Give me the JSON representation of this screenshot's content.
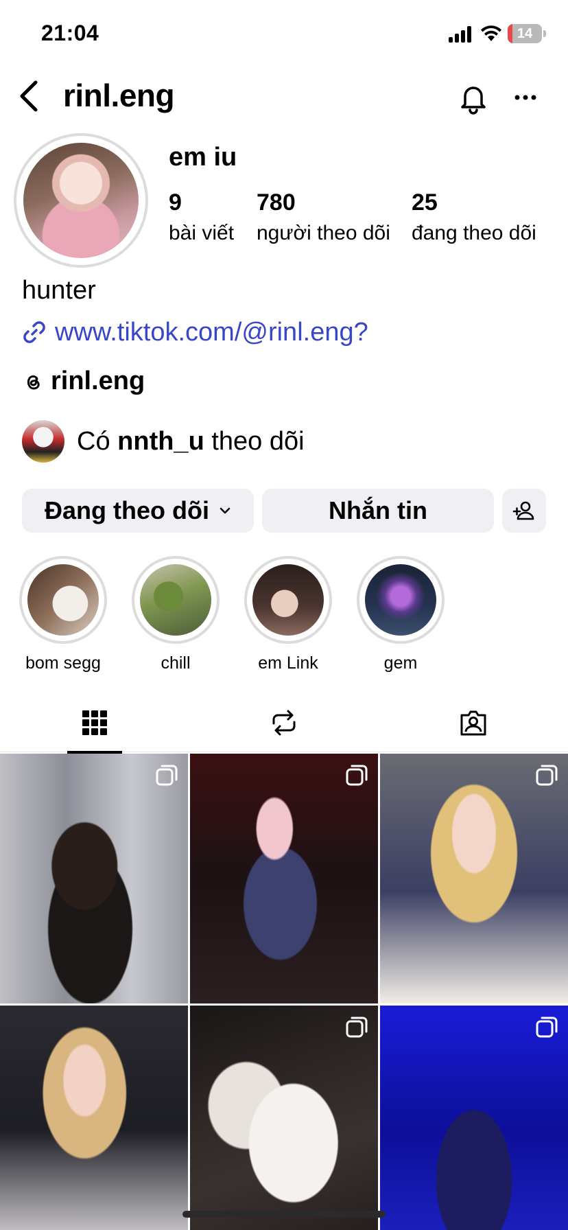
{
  "status_bar": {
    "time": "21:04",
    "battery": "14",
    "battery_level": 0.14
  },
  "header": {
    "username": "rinl.eng"
  },
  "profile": {
    "display_name": "em iu",
    "stats": [
      {
        "value": "9",
        "label": "bài viết"
      },
      {
        "value": "780",
        "label": "người theo dõi"
      },
      {
        "value": "25",
        "label": "đang theo dõi"
      }
    ],
    "bio": "hunter",
    "link": "www.tiktok.com/@rinl.eng?",
    "threads_handle": "rinl.eng",
    "mutual": {
      "prefix": "Có",
      "user": "nnth_u",
      "suffix": "theo dõi"
    }
  },
  "actions": {
    "following_label": "Đang theo dõi",
    "message_label": "Nhắn tin"
  },
  "highlights": [
    {
      "label": "bom segg"
    },
    {
      "label": "chill"
    },
    {
      "label": "em Link"
    },
    {
      "label": "gem"
    }
  ],
  "tabs": [
    {
      "icon": "grid-icon",
      "active": true
    },
    {
      "icon": "repost-icon",
      "active": false
    },
    {
      "icon": "tagged-icon",
      "active": false
    }
  ],
  "posts": [
    {
      "multi": true
    },
    {
      "multi": true
    },
    {
      "multi": true
    },
    {
      "multi": false
    },
    {
      "multi": true
    },
    {
      "multi": true
    }
  ],
  "colors": {
    "link": "#3a46c9",
    "button_bg": "#efeff4",
    "battery_low": "#e5484d"
  }
}
